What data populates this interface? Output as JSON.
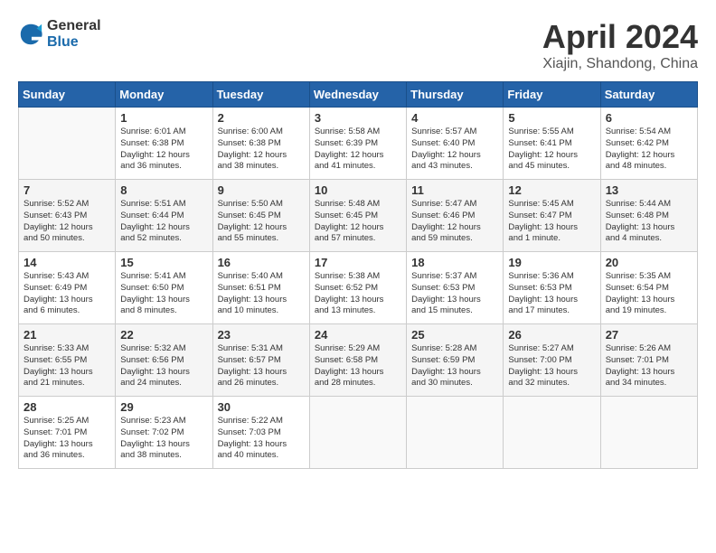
{
  "header": {
    "logo_general": "General",
    "logo_blue": "Blue",
    "month_title": "April 2024",
    "subtitle": "Xiajin, Shandong, China"
  },
  "days_of_week": [
    "Sunday",
    "Monday",
    "Tuesday",
    "Wednesday",
    "Thursday",
    "Friday",
    "Saturday"
  ],
  "weeks": [
    [
      {
        "day": "",
        "info": ""
      },
      {
        "day": "1",
        "info": "Sunrise: 6:01 AM\nSunset: 6:38 PM\nDaylight: 12 hours\nand 36 minutes."
      },
      {
        "day": "2",
        "info": "Sunrise: 6:00 AM\nSunset: 6:38 PM\nDaylight: 12 hours\nand 38 minutes."
      },
      {
        "day": "3",
        "info": "Sunrise: 5:58 AM\nSunset: 6:39 PM\nDaylight: 12 hours\nand 41 minutes."
      },
      {
        "day": "4",
        "info": "Sunrise: 5:57 AM\nSunset: 6:40 PM\nDaylight: 12 hours\nand 43 minutes."
      },
      {
        "day": "5",
        "info": "Sunrise: 5:55 AM\nSunset: 6:41 PM\nDaylight: 12 hours\nand 45 minutes."
      },
      {
        "day": "6",
        "info": "Sunrise: 5:54 AM\nSunset: 6:42 PM\nDaylight: 12 hours\nand 48 minutes."
      }
    ],
    [
      {
        "day": "7",
        "info": "Sunrise: 5:52 AM\nSunset: 6:43 PM\nDaylight: 12 hours\nand 50 minutes."
      },
      {
        "day": "8",
        "info": "Sunrise: 5:51 AM\nSunset: 6:44 PM\nDaylight: 12 hours\nand 52 minutes."
      },
      {
        "day": "9",
        "info": "Sunrise: 5:50 AM\nSunset: 6:45 PM\nDaylight: 12 hours\nand 55 minutes."
      },
      {
        "day": "10",
        "info": "Sunrise: 5:48 AM\nSunset: 6:45 PM\nDaylight: 12 hours\nand 57 minutes."
      },
      {
        "day": "11",
        "info": "Sunrise: 5:47 AM\nSunset: 6:46 PM\nDaylight: 12 hours\nand 59 minutes."
      },
      {
        "day": "12",
        "info": "Sunrise: 5:45 AM\nSunset: 6:47 PM\nDaylight: 13 hours\nand 1 minute."
      },
      {
        "day": "13",
        "info": "Sunrise: 5:44 AM\nSunset: 6:48 PM\nDaylight: 13 hours\nand 4 minutes."
      }
    ],
    [
      {
        "day": "14",
        "info": "Sunrise: 5:43 AM\nSunset: 6:49 PM\nDaylight: 13 hours\nand 6 minutes."
      },
      {
        "day": "15",
        "info": "Sunrise: 5:41 AM\nSunset: 6:50 PM\nDaylight: 13 hours\nand 8 minutes."
      },
      {
        "day": "16",
        "info": "Sunrise: 5:40 AM\nSunset: 6:51 PM\nDaylight: 13 hours\nand 10 minutes."
      },
      {
        "day": "17",
        "info": "Sunrise: 5:38 AM\nSunset: 6:52 PM\nDaylight: 13 hours\nand 13 minutes."
      },
      {
        "day": "18",
        "info": "Sunrise: 5:37 AM\nSunset: 6:53 PM\nDaylight: 13 hours\nand 15 minutes."
      },
      {
        "day": "19",
        "info": "Sunrise: 5:36 AM\nSunset: 6:53 PM\nDaylight: 13 hours\nand 17 minutes."
      },
      {
        "day": "20",
        "info": "Sunrise: 5:35 AM\nSunset: 6:54 PM\nDaylight: 13 hours\nand 19 minutes."
      }
    ],
    [
      {
        "day": "21",
        "info": "Sunrise: 5:33 AM\nSunset: 6:55 PM\nDaylight: 13 hours\nand 21 minutes."
      },
      {
        "day": "22",
        "info": "Sunrise: 5:32 AM\nSunset: 6:56 PM\nDaylight: 13 hours\nand 24 minutes."
      },
      {
        "day": "23",
        "info": "Sunrise: 5:31 AM\nSunset: 6:57 PM\nDaylight: 13 hours\nand 26 minutes."
      },
      {
        "day": "24",
        "info": "Sunrise: 5:29 AM\nSunset: 6:58 PM\nDaylight: 13 hours\nand 28 minutes."
      },
      {
        "day": "25",
        "info": "Sunrise: 5:28 AM\nSunset: 6:59 PM\nDaylight: 13 hours\nand 30 minutes."
      },
      {
        "day": "26",
        "info": "Sunrise: 5:27 AM\nSunset: 7:00 PM\nDaylight: 13 hours\nand 32 minutes."
      },
      {
        "day": "27",
        "info": "Sunrise: 5:26 AM\nSunset: 7:01 PM\nDaylight: 13 hours\nand 34 minutes."
      }
    ],
    [
      {
        "day": "28",
        "info": "Sunrise: 5:25 AM\nSunset: 7:01 PM\nDaylight: 13 hours\nand 36 minutes."
      },
      {
        "day": "29",
        "info": "Sunrise: 5:23 AM\nSunset: 7:02 PM\nDaylight: 13 hours\nand 38 minutes."
      },
      {
        "day": "30",
        "info": "Sunrise: 5:22 AM\nSunset: 7:03 PM\nDaylight: 13 hours\nand 40 minutes."
      },
      {
        "day": "",
        "info": ""
      },
      {
        "day": "",
        "info": ""
      },
      {
        "day": "",
        "info": ""
      },
      {
        "day": "",
        "info": ""
      }
    ]
  ]
}
